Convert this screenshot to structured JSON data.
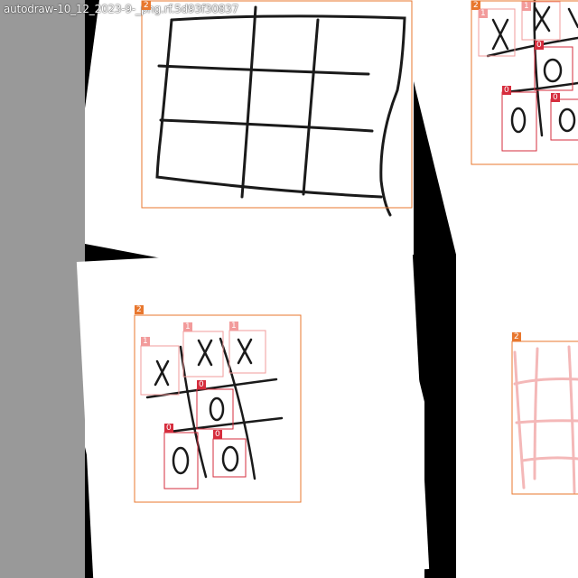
{
  "image": {
    "filename_label": "autodraw-10_12_2023-9-_png.rf.5d93f30837",
    "colors": {
      "left_bar": "#999999",
      "background": "#ffffff",
      "mat_black": "#000000",
      "ink": "#1a1a1a",
      "class_2": "#e8772e",
      "class_1": "#f29b9b",
      "class_0": "#d62d3d",
      "faded_ink": "#f4b8b8"
    }
  },
  "annotations": {
    "main_board_label": "2",
    "top_right_labels": [
      "2",
      "1",
      "1",
      "0",
      "0",
      "0"
    ],
    "center_board_label": "2",
    "center_x_labels": [
      "1",
      "1",
      "1"
    ],
    "center_o_labels": [
      "0",
      "0",
      "0"
    ],
    "right_faded_label": "2"
  }
}
